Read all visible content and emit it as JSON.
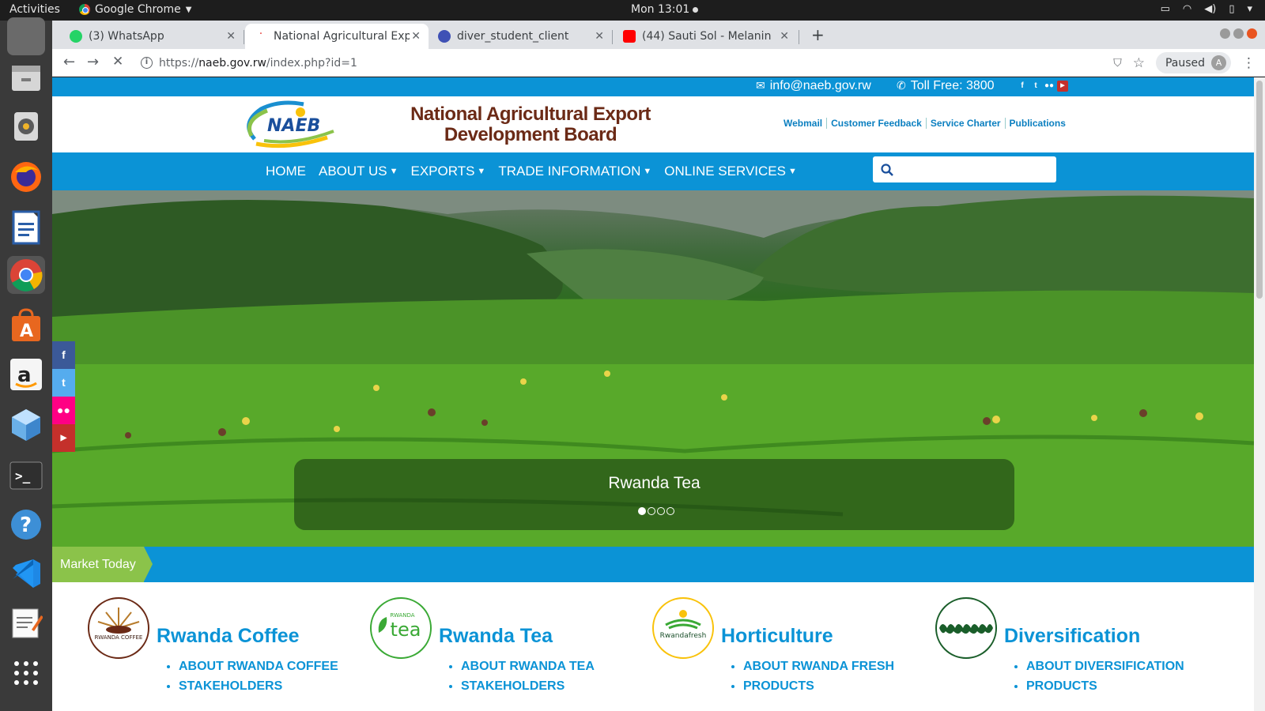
{
  "desktop": {
    "activities": "Activities",
    "app_name": "Google Chrome",
    "clock": "Mon 13:01"
  },
  "dock": {
    "items": [
      "files-icon",
      "file-manager-icon",
      "sound-icon",
      "firefox-icon",
      "writer-icon",
      "chrome-icon",
      "software-center-icon",
      "amazon-icon",
      "cube-icon",
      "terminal-icon",
      "help-icon",
      "vscode-icon",
      "text-editor-icon",
      "app-grid-icon"
    ]
  },
  "browser": {
    "tabs": [
      {
        "title": "(3) WhatsApp",
        "favicon_color": "#25d366"
      },
      {
        "title": "National Agricultural Exp",
        "favicon_color": "#e53935"
      },
      {
        "title": "diver_student_client",
        "favicon_color": "#3f51b5"
      },
      {
        "title": "(44) Sauti Sol - Melanin",
        "favicon_color": "#ff0000"
      }
    ],
    "url_prefix": "https://",
    "url_host": "naeb.gov.rw",
    "url_path": "/index.php?id=1",
    "profile_status": "Paused",
    "profile_initial": "A"
  },
  "site": {
    "email": "info@naeb.gov.rw",
    "toll_free": "Toll Free: 3800",
    "logo_text": "NAEB",
    "org_title_line1": "National Agricultural Export",
    "org_title_line2": "Development Board",
    "top_links": [
      "Webmail",
      "Customer Feedback",
      "Service Charter",
      "Publications"
    ],
    "menu": [
      {
        "label": "HOME",
        "dropdown": false
      },
      {
        "label": "ABOUT US",
        "dropdown": true
      },
      {
        "label": "EXPORTS",
        "dropdown": true
      },
      {
        "label": "TRADE INFORMATION",
        "dropdown": true
      },
      {
        "label": "ONLINE SERVICES",
        "dropdown": true
      }
    ],
    "search_placeholder": "",
    "slider": {
      "caption": "Rwanda Tea",
      "slide_count": 4,
      "active_slide": 1
    },
    "market_label": "Market Today",
    "sectors": [
      {
        "title": "Rwanda Coffee",
        "badge_text": "RWANDA COFFEE",
        "links": [
          "ABOUT RWANDA COFFEE",
          "STAKEHOLDERS"
        ]
      },
      {
        "title": "Rwanda Tea",
        "badge_text": "tea",
        "badge_subtext": "RWANDA",
        "links": [
          "ABOUT RWANDA TEA",
          "STAKEHOLDERS"
        ]
      },
      {
        "title": "Horticulture",
        "badge_text": "Rwandafresh",
        "links": [
          "ABOUT RWANDA FRESH",
          "PRODUCTS"
        ]
      },
      {
        "title": "Diversification",
        "badge_text": "",
        "links": [
          "ABOUT DIVERSIFICATION",
          "PRODUCTS"
        ]
      }
    ]
  },
  "colors": {
    "brand_blue": "#0b93d6",
    "brand_brown": "#6b2a16",
    "market_green": "#8bc34a"
  }
}
